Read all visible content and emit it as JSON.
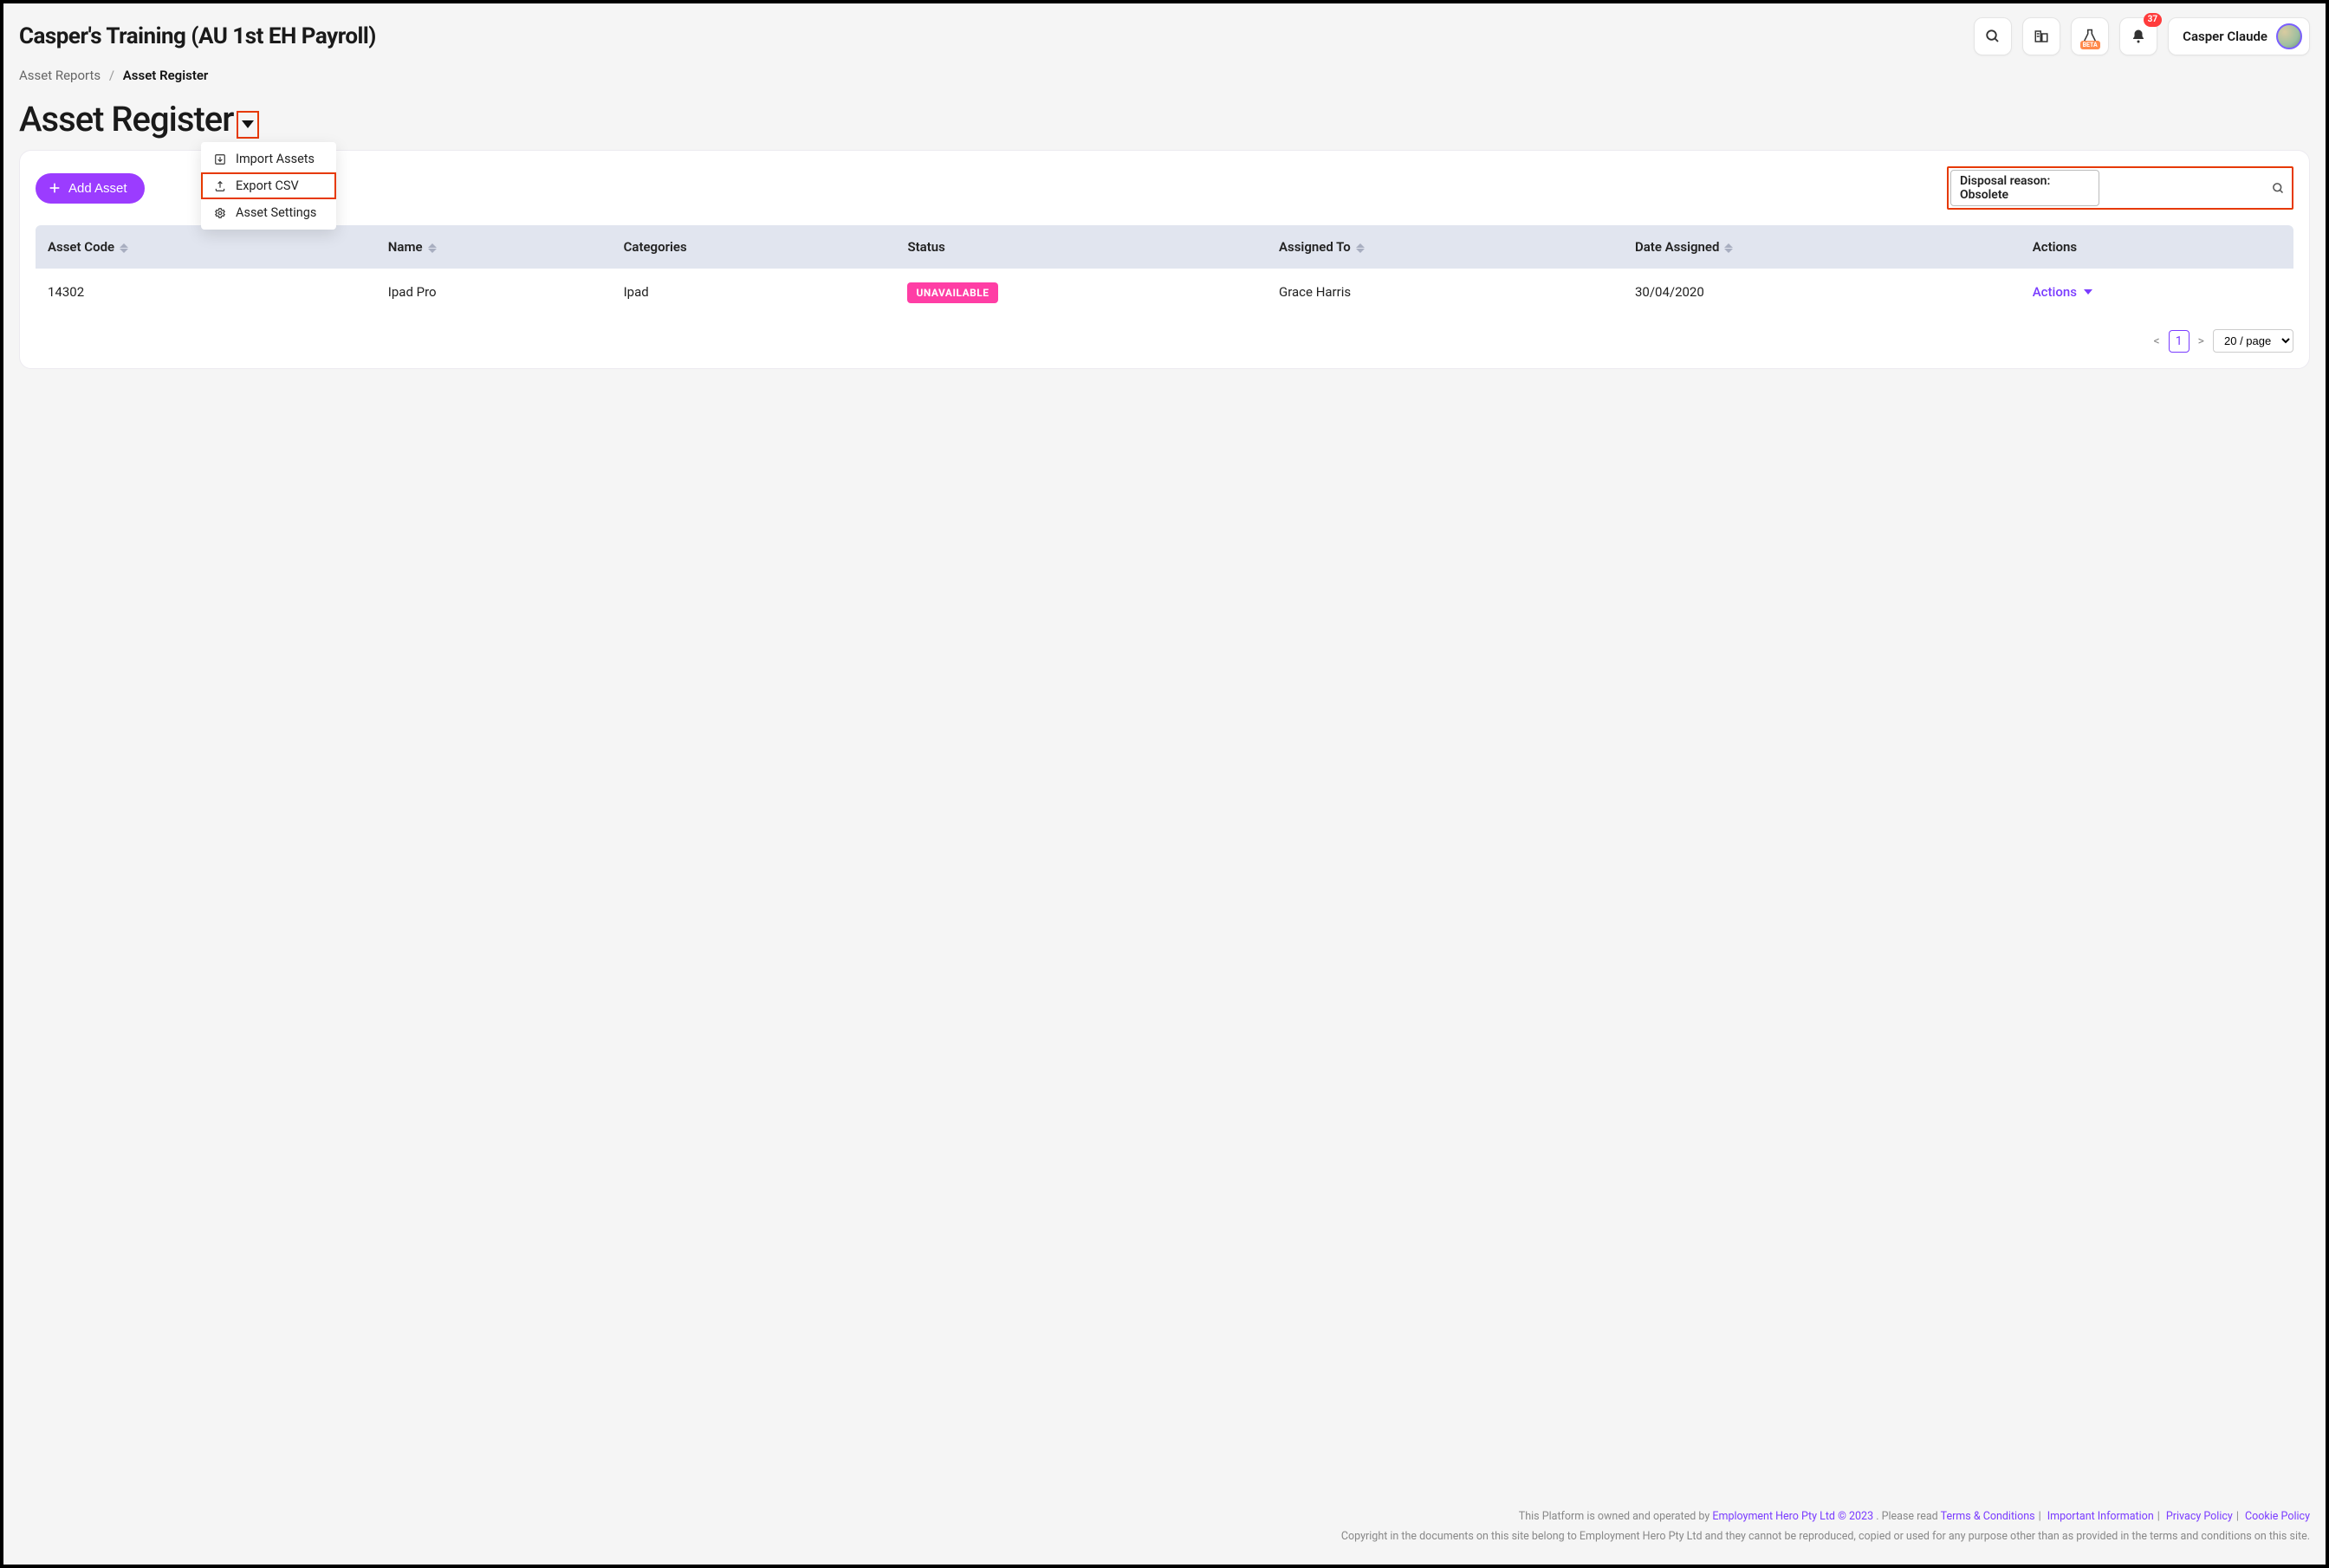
{
  "header": {
    "org_title": "Casper's Training (AU 1st EH Payroll)",
    "notification_count": "37",
    "user_name": "Casper Claude",
    "beta_label": "BETA"
  },
  "breadcrumb": {
    "parent": "Asset Reports",
    "current": "Asset Register"
  },
  "page": {
    "title": "Asset Register"
  },
  "dropdown": {
    "items": [
      {
        "label": "Import Assets",
        "icon": "import-icon"
      },
      {
        "label": "Export CSV",
        "icon": "export-icon"
      },
      {
        "label": "Asset Settings",
        "icon": "gear-icon"
      }
    ]
  },
  "toolbar": {
    "add_label": "Add Asset",
    "search_filter": "Disposal reason: Obsolete"
  },
  "table": {
    "columns": [
      "Asset Code",
      "Name",
      "Categories",
      "Status",
      "Assigned To",
      "Date Assigned",
      "Actions"
    ],
    "rows": [
      {
        "code": "14302",
        "name": "Ipad Pro",
        "categories": "Ipad",
        "status": "UNAVAILABLE",
        "assigned_to": "Grace Harris",
        "date_assigned": "30/04/2020",
        "action_label": "Actions"
      }
    ]
  },
  "pager": {
    "page": "1",
    "page_size_label": "20 / page"
  },
  "footer": {
    "line1_prefix": "This Platform is owned and operated by ",
    "owner_link": "Employment Hero Pty Ltd © 2023",
    "line1_mid": ". Please read ",
    "links": [
      "Terms & Conditions",
      "Important Information",
      "Privacy Policy",
      "Cookie Policy"
    ],
    "line2": "Copyright in the documents on this site belong to Employment Hero Pty Ltd and they cannot be reproduced, copied or used for any purpose other than as provided in the terms and conditions on this site."
  }
}
